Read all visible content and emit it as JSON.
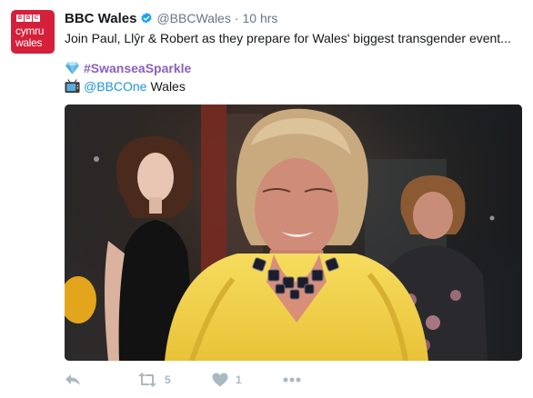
{
  "avatar": {
    "brand_letters": [
      "B",
      "B",
      "C"
    ],
    "line1": "cymru",
    "line2": "wales",
    "bg_color": "#d4203a"
  },
  "tweet": {
    "name": "BBC Wales",
    "handle": "@BBCWales",
    "separator": "·",
    "time": "10 hrs",
    "text": "Join Paul, Llŷr & Robert as they prepare for Wales' biggest transgender event...",
    "diamond_emoji": "gem-icon",
    "hashtag": "#SwanseaSparkle",
    "tv_emoji": "television-icon",
    "mention": "@BBCOne",
    "mention_suffix": "Wales",
    "accent_color": "#1b95e0",
    "hashtag_color": "#8a5fbf"
  },
  "actions": {
    "retweet_count": "5",
    "like_count": "1"
  }
}
